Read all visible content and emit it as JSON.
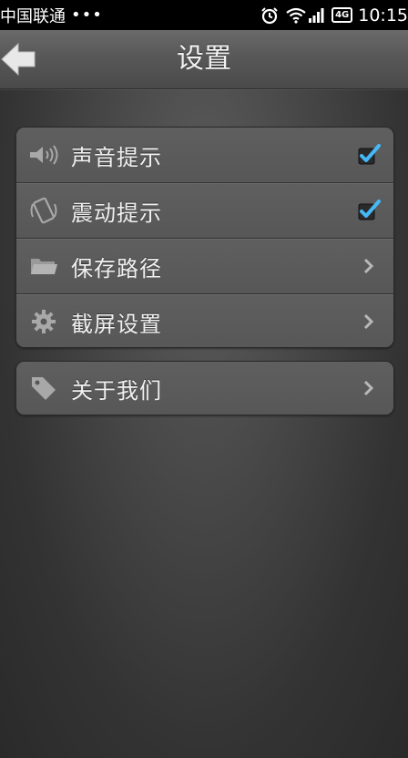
{
  "status_bar": {
    "carrier": "中国联通",
    "dots": "•••",
    "network_badge": "4G",
    "time": "10:15"
  },
  "header": {
    "title": "设置"
  },
  "settings_group": {
    "items": [
      {
        "label": "声音提示",
        "icon": "speaker-icon",
        "control": "checkbox",
        "checked": true
      },
      {
        "label": "震动提示",
        "icon": "vibrate-phone-icon",
        "control": "checkbox",
        "checked": true
      },
      {
        "label": "保存路径",
        "icon": "folder-icon",
        "control": "chevron"
      },
      {
        "label": "截屏设置",
        "icon": "gear-icon",
        "control": "chevron"
      }
    ]
  },
  "about_group": {
    "items": [
      {
        "label": "关于我们",
        "icon": "tag-icon",
        "control": "chevron"
      }
    ]
  },
  "colors": {
    "checkmark": "#45b8f5",
    "background": "#3a3a3a",
    "status_bar": "#000000"
  }
}
